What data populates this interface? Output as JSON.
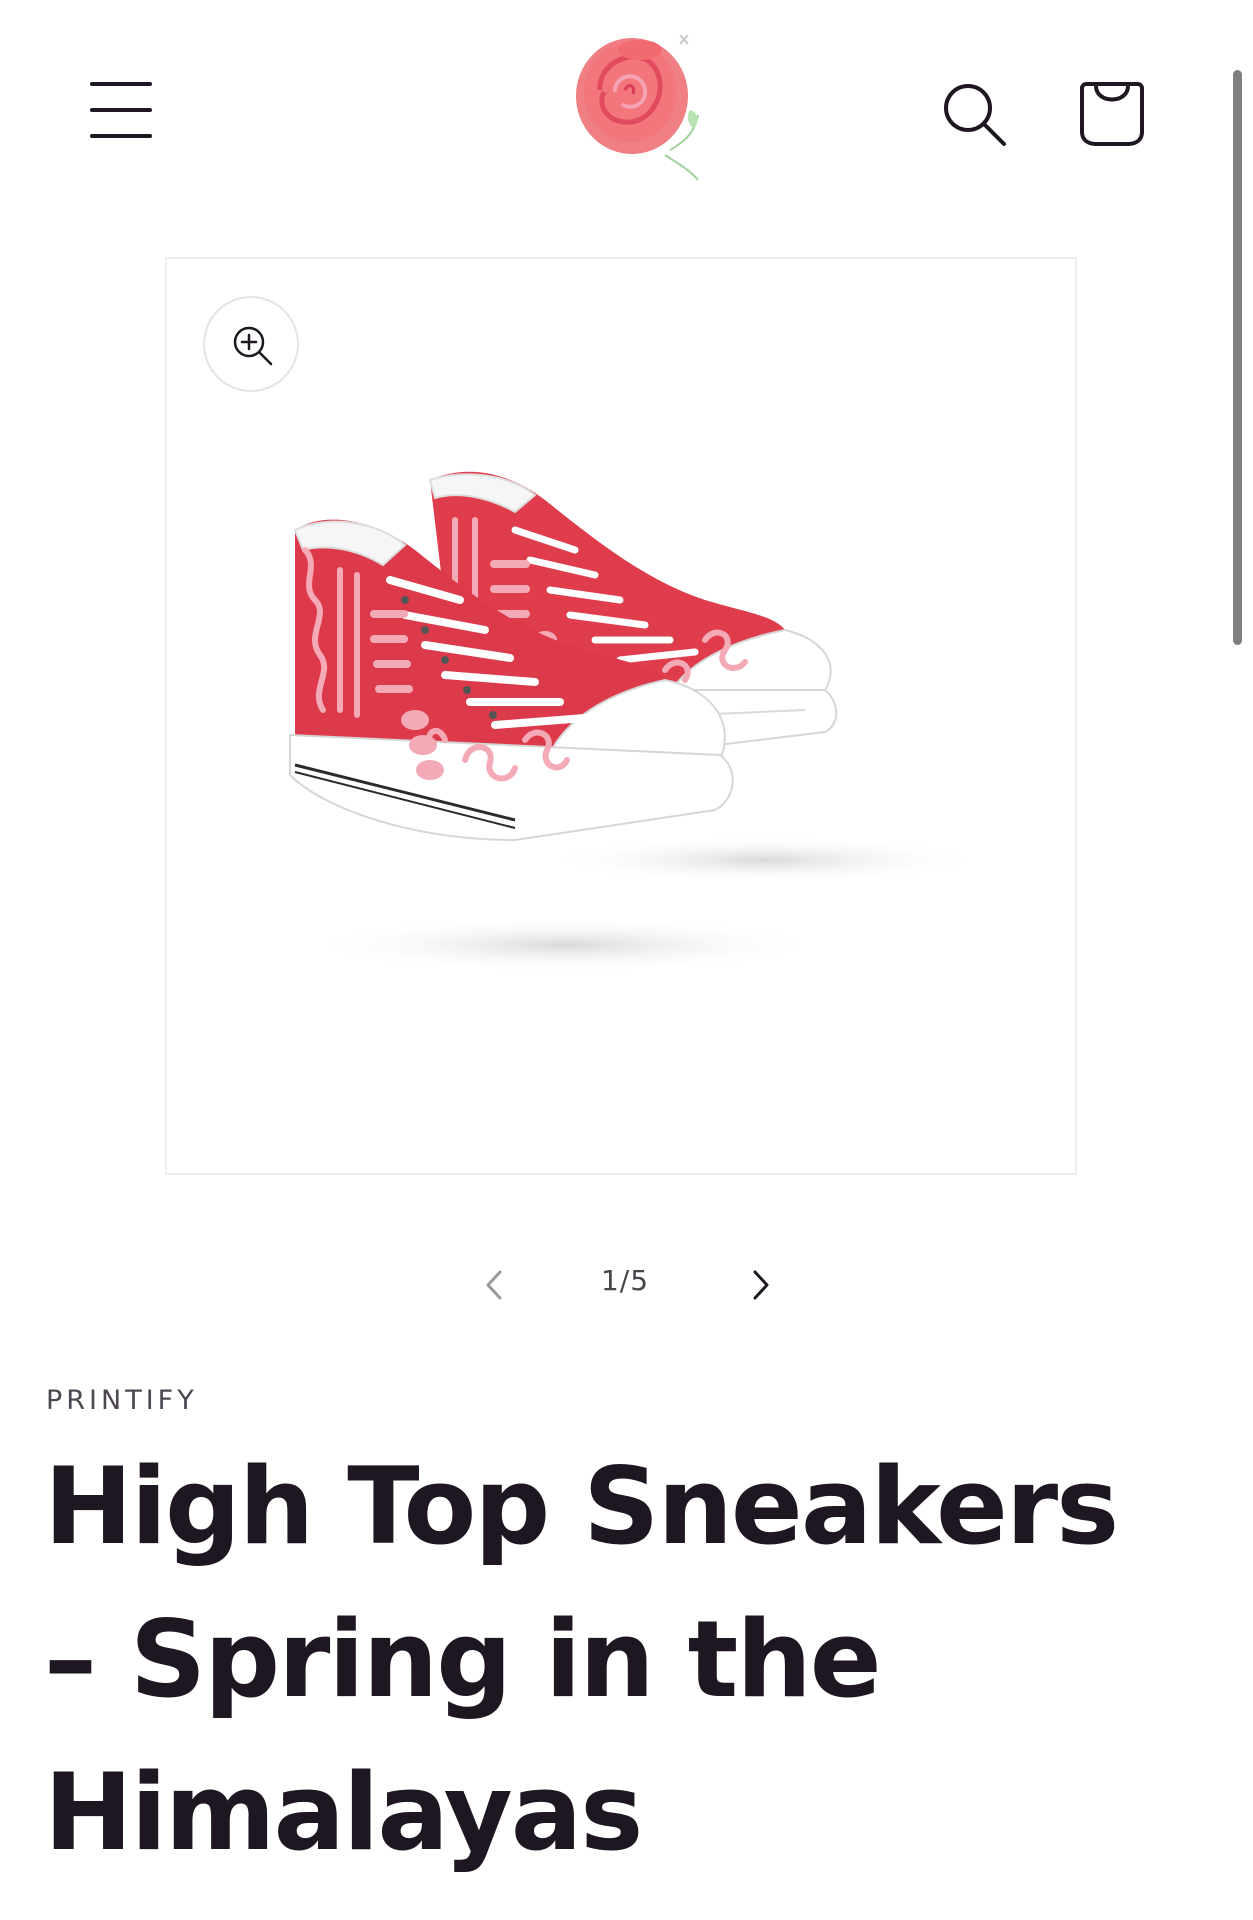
{
  "header": {
    "menu_icon": "hamburger-menu-icon",
    "logo_icon": "rose-logo-icon",
    "search_icon": "search-icon",
    "cart_icon": "shopping-bag-icon"
  },
  "gallery": {
    "zoom_icon": "zoom-in-icon",
    "image_subject": "red-high-top-sneakers",
    "counter": "1/5",
    "prev_icon": "chevron-left-icon",
    "next_icon": "chevron-right-icon"
  },
  "product": {
    "vendor": "PRINTIFY",
    "title": "High Top Sneakers – Spring in the Himalayas"
  },
  "colors": {
    "text": "#1e1621",
    "shoe_red": "#dd3b4a",
    "pattern_pink": "#f3a9b5",
    "border": "#eeeeee"
  }
}
